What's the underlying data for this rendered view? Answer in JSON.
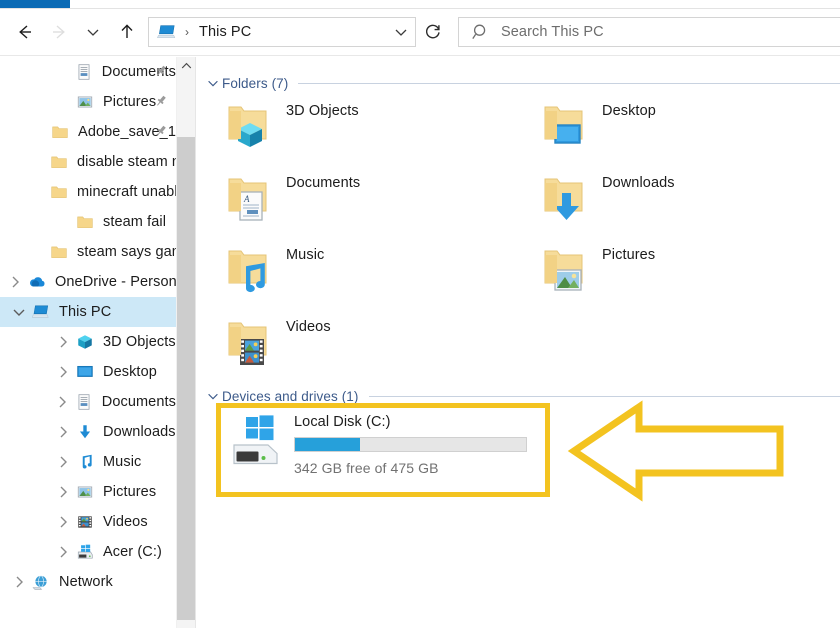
{
  "window": {
    "ribbon_active_tab": "",
    "accent_color": "#0c6bb5",
    "annotation_color": "#f3c320",
    "progress_color": "#26a0da"
  },
  "nav": {
    "back_tooltip": "Back",
    "forward_tooltip": "Forward",
    "recent_tooltip": "Recent locations",
    "up_tooltip": "Up",
    "refresh_tooltip": "Refresh"
  },
  "address": {
    "separator": "›",
    "crumb": "This PC",
    "icon": "this-pc-icon"
  },
  "search": {
    "placeholder": "Search This PC",
    "value": "",
    "icon": "search-icon"
  },
  "sidebar": {
    "items": [
      {
        "label": "Documents",
        "icon": "documents-icon",
        "level": 1,
        "twisty": "",
        "pinned": true,
        "selected": false
      },
      {
        "label": "Pictures",
        "icon": "pictures-icon",
        "level": 1,
        "twisty": "",
        "pinned": true,
        "selected": false
      },
      {
        "label": "Adobe_save_1",
        "icon": "folder-icon",
        "level": 1,
        "twisty": "",
        "pinned": true,
        "selected": false
      },
      {
        "label": "disable steam no",
        "icon": "folder-icon",
        "level": 1,
        "twisty": "",
        "pinned": false,
        "selected": false
      },
      {
        "label": "minecraft unable",
        "icon": "folder-icon",
        "level": 1,
        "twisty": "",
        "pinned": false,
        "selected": false
      },
      {
        "label": "steam fail",
        "icon": "folder-icon",
        "level": 1,
        "twisty": "",
        "pinned": false,
        "selected": false
      },
      {
        "label": "steam says game",
        "icon": "folder-icon",
        "level": 1,
        "twisty": "",
        "pinned": false,
        "selected": false
      },
      {
        "label": "OneDrive - Person",
        "icon": "onedrive-icon",
        "level": 0,
        "twisty": "collapsed",
        "pinned": false,
        "selected": false
      },
      {
        "label": "This PC",
        "icon": "this-pc-icon",
        "level": 0,
        "twisty": "expanded",
        "pinned": false,
        "selected": true
      },
      {
        "label": "3D Objects",
        "icon": "3d-objects-icon",
        "level": 1,
        "twisty": "collapsed",
        "pinned": false,
        "selected": false
      },
      {
        "label": "Desktop",
        "icon": "desktop-icon",
        "level": 1,
        "twisty": "collapsed",
        "pinned": false,
        "selected": false
      },
      {
        "label": "Documents",
        "icon": "documents-icon",
        "level": 1,
        "twisty": "collapsed",
        "pinned": false,
        "selected": false
      },
      {
        "label": "Downloads",
        "icon": "downloads-icon",
        "level": 1,
        "twisty": "collapsed",
        "pinned": false,
        "selected": false
      },
      {
        "label": "Music",
        "icon": "music-icon",
        "level": 1,
        "twisty": "collapsed",
        "pinned": false,
        "selected": false
      },
      {
        "label": "Pictures",
        "icon": "pictures-icon",
        "level": 1,
        "twisty": "collapsed",
        "pinned": false,
        "selected": false
      },
      {
        "label": "Videos",
        "icon": "videos-icon",
        "level": 1,
        "twisty": "collapsed",
        "pinned": false,
        "selected": false
      },
      {
        "label": "Acer (C:)",
        "icon": "drive-icon",
        "level": 1,
        "twisty": "collapsed",
        "pinned": false,
        "selected": false
      },
      {
        "label": "Network",
        "icon": "network-icon",
        "level": 0,
        "twisty": "collapsed",
        "pinned": false,
        "selected": false
      }
    ]
  },
  "main": {
    "groups": [
      {
        "label": "Folders (7)",
        "expanded": true
      },
      {
        "label": "Devices and drives (1)",
        "expanded": true
      }
    ],
    "folders": [
      {
        "name": "3D Objects",
        "icon": "folder-3d-objects-icon"
      },
      {
        "name": "Desktop",
        "icon": "folder-desktop-icon"
      },
      {
        "name": "Documents",
        "icon": "folder-documents-icon"
      },
      {
        "name": "Downloads",
        "icon": "folder-downloads-icon"
      },
      {
        "name": "Music",
        "icon": "folder-music-icon"
      },
      {
        "name": "Pictures",
        "icon": "folder-pictures-icon"
      },
      {
        "name": "Videos",
        "icon": "folder-videos-icon"
      }
    ],
    "drives": [
      {
        "name": "Local Disk (C:)",
        "icon": "windows-drive-icon",
        "free_text": "342 GB free of 475 GB",
        "free_gb": 342,
        "total_gb": 475,
        "used_percent": 28,
        "highlighted": true
      }
    ]
  },
  "annotations": {
    "highlight_box": {
      "target": "Local Disk (C:)",
      "shape": "rectangle",
      "color": "#f3c320"
    },
    "arrow": {
      "direction": "left",
      "points_to": "Local Disk (C:)",
      "color": "#f3c320"
    }
  }
}
